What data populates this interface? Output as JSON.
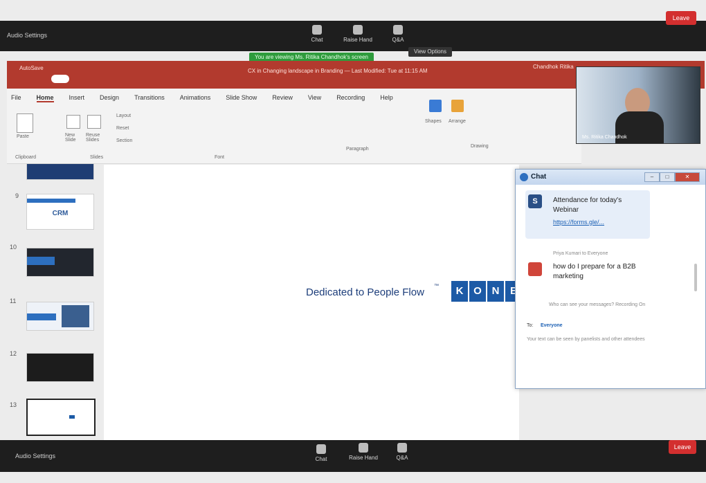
{
  "zoom": {
    "top_bar": {
      "audio_settings": "Audio Settings",
      "buttons": [
        "Chat",
        "Raise Hand",
        "Q&A"
      ],
      "leave": "Leave"
    },
    "bottom_bar": {
      "audio_settings": "Audio Settings",
      "buttons": [
        "Chat",
        "Raise Hand",
        "Q&A"
      ],
      "leave": "Leave"
    },
    "share_banner": "You are viewing Ms. Ritika Chandhok's screen",
    "view_options": "View Options"
  },
  "ppt": {
    "document_title": "CX in Changing landscape in Branding — Last Modified: Tue at 11:15 AM",
    "autosave": "AutoSave",
    "user": "Chandhok Ritika",
    "tabs": [
      "File",
      "Home",
      "Insert",
      "Design",
      "Transitions",
      "Animations",
      "Slide Show",
      "Review",
      "View",
      "Recording",
      "Help"
    ],
    "ribbon": {
      "paste": "Paste",
      "clipboard": "Clipboard",
      "new_slide": "New Slide",
      "reuse_slides": "Reuse Slides",
      "slides_group": "Slides",
      "layout": "Layout",
      "reset": "Reset",
      "section": "Section",
      "font_group": "Font",
      "paragraph_group": "Paragraph",
      "shapes": "Shapes",
      "arrange": "Arrange",
      "drawing_group": "Drawing"
    }
  },
  "slides": [
    {
      "num": "9",
      "label": "CRM"
    },
    {
      "num": "10",
      "label": ""
    },
    {
      "num": "11",
      "label": ""
    },
    {
      "num": "12",
      "label": ""
    },
    {
      "num": "13",
      "label": ""
    }
  ],
  "canvas": {
    "tagline": "Dedicated to People Flow",
    "trademark": "™",
    "logo_letters": [
      "K",
      "O",
      "N",
      "E"
    ]
  },
  "webcam": {
    "name": "Ms. Ritika Chandhok"
  },
  "chat": {
    "title": "Chat",
    "messages": [
      {
        "avatar": "S",
        "text": "Attendance for today's Webinar",
        "link": "https://forms.gle/..."
      },
      {
        "sender_line": "Priya Kumari to Everyone",
        "text": "how do I prepare for a B2B marketing"
      }
    ],
    "who_can_see": "Who can see your messages? Recording On",
    "to_label": "To:",
    "to_value": "Everyone",
    "placeholder": "Your text can be seen by panelists and other attendees"
  },
  "colors": {
    "ppt_red": "#b23a2e",
    "zoom_dark": "#1e1e1e",
    "kone_blue": "#1c5aa6",
    "leave_red": "#d32f2f"
  }
}
